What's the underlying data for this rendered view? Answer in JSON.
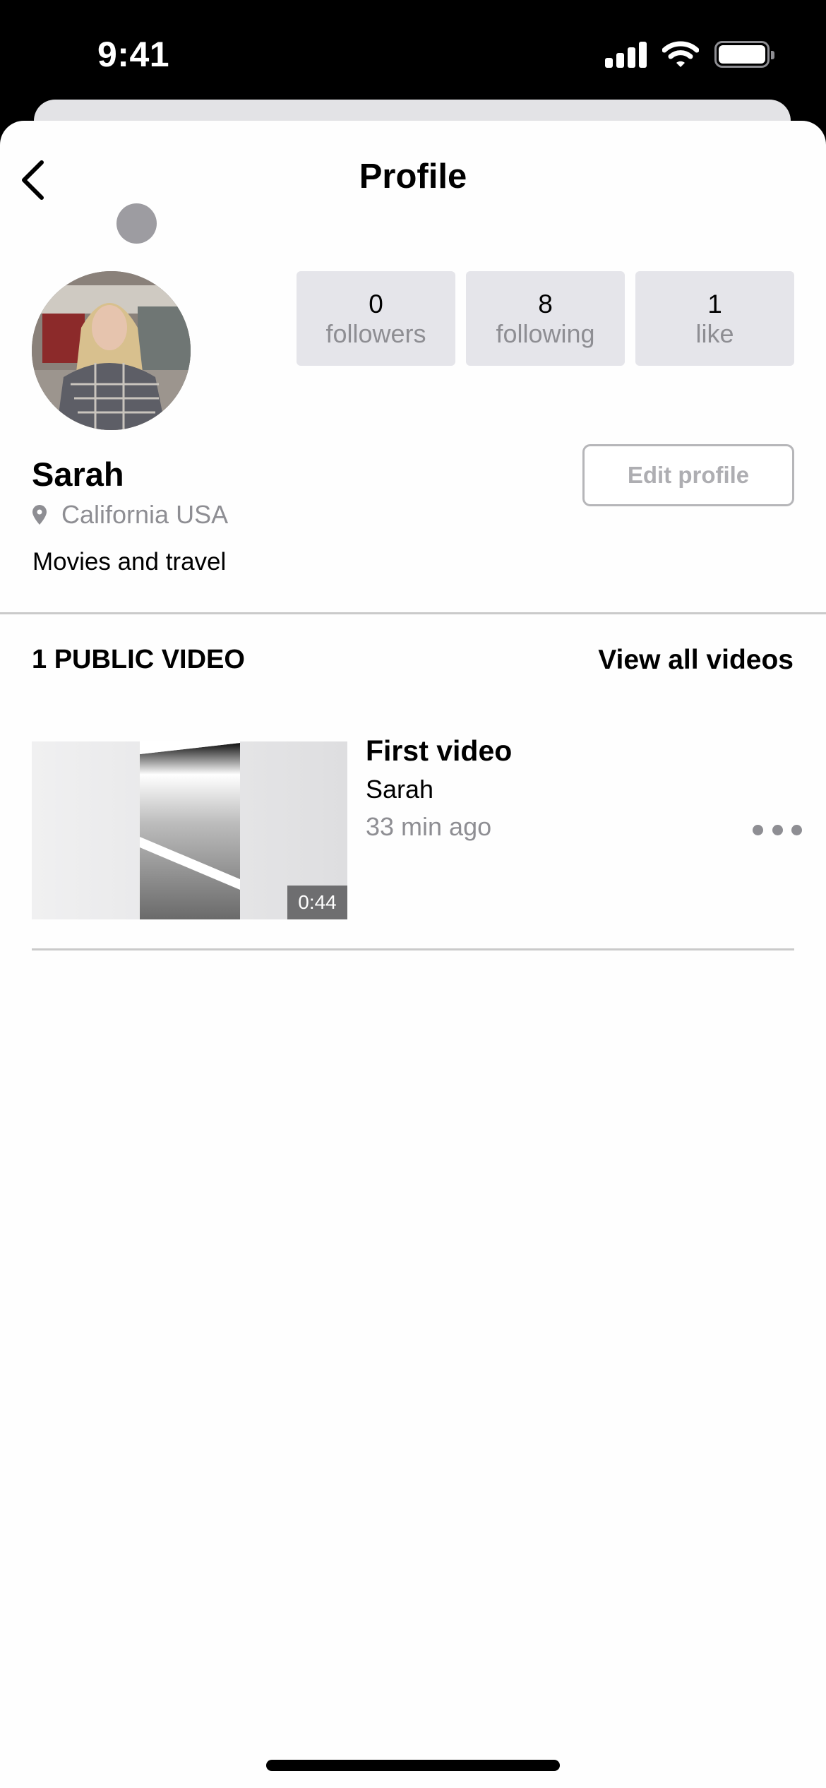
{
  "status_bar": {
    "time": "9:41",
    "icons": [
      "cellular-signal-icon",
      "wifi-icon",
      "battery-icon"
    ]
  },
  "nav": {
    "title": "Profile",
    "back_icon": "chevron-left-icon"
  },
  "profile": {
    "name": "Sarah",
    "location": "California USA",
    "location_icon": "map-pin-icon",
    "bio": "Movies and travel",
    "edit_label": "Edit profile",
    "stats": [
      {
        "value": "0",
        "label": "followers"
      },
      {
        "value": "8",
        "label": "following"
      },
      {
        "value": "1",
        "label": "like"
      }
    ]
  },
  "videos": {
    "section_title": "1 PUBLIC VIDEO",
    "view_all_label": "View all videos",
    "items": [
      {
        "title": "First video",
        "author": "Sarah",
        "time_ago": "33 min ago",
        "duration": "0:44",
        "more_icon": "more-horizontal-icon"
      }
    ]
  },
  "colors": {
    "secondary_text": "#8e8e93",
    "stat_bg": "#e5e5ea",
    "divider": "#cacaca"
  }
}
